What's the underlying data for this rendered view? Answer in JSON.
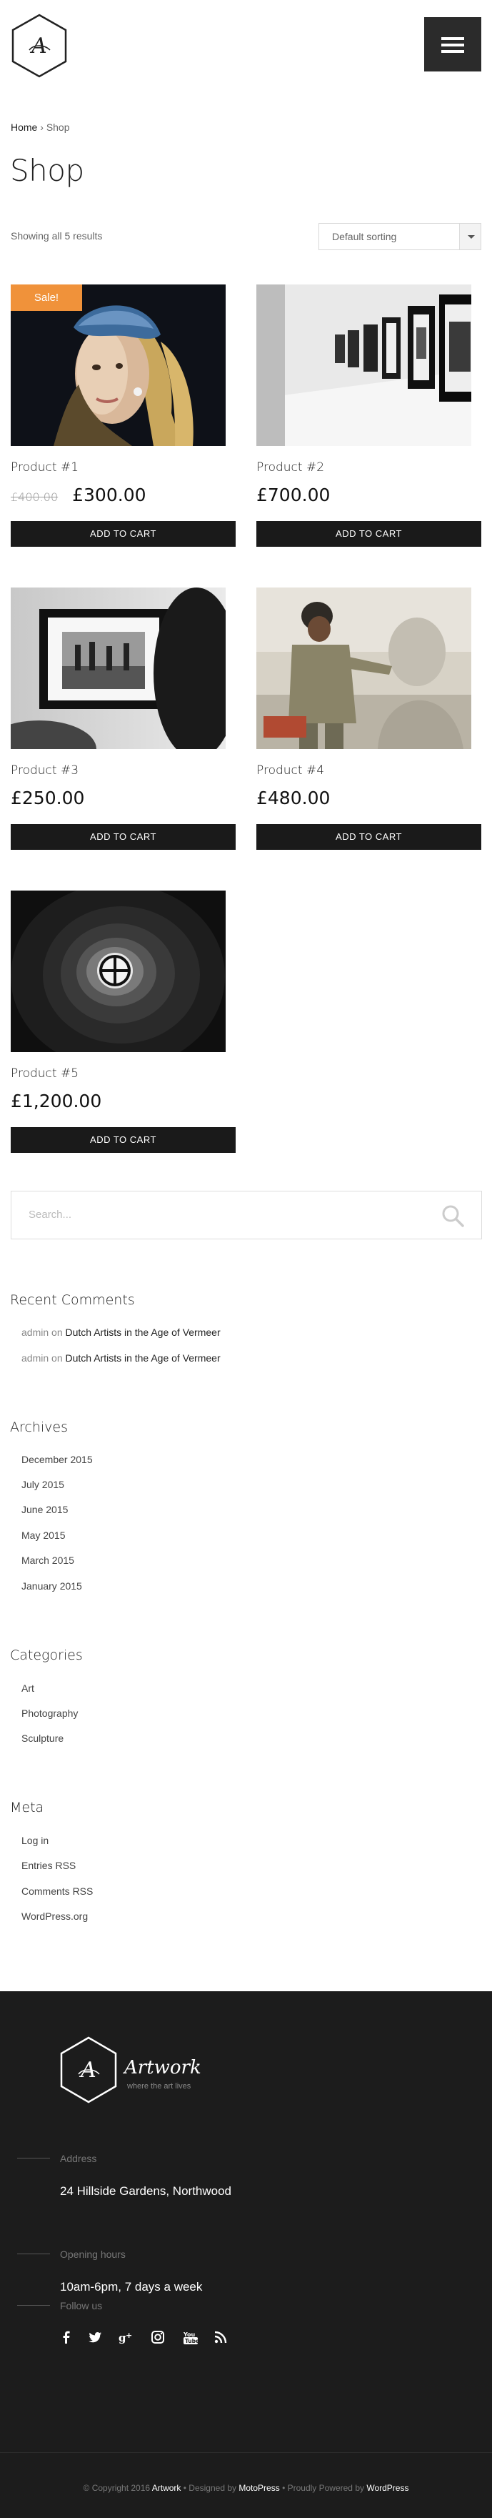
{
  "header": {
    "menu_icon": "hamburger-menu-icon",
    "logo_icon": "hexagon-monogram-logo-icon"
  },
  "breadcrumb": {
    "home": "Home",
    "separator": "›",
    "current": "Shop"
  },
  "page_title": "Shop",
  "toolbar": {
    "result_count": "Showing all 5 results",
    "sorting_value": "Default sorting"
  },
  "products": [
    {
      "name": "Product #1",
      "sale_badge": "Sale!",
      "old_price": "£400.00",
      "price": "£300.00",
      "button": "ADD TO CART"
    },
    {
      "name": "Product #2",
      "price": "£700.00",
      "button": "ADD TO CART"
    },
    {
      "name": "Product #3",
      "price": "£250.00",
      "button": "ADD TO CART"
    },
    {
      "name": "Product #4",
      "price": "£480.00",
      "button": "ADD TO CART"
    },
    {
      "name": "Product #5",
      "price": "£1,200.00",
      "button": "ADD TO CART"
    }
  ],
  "search": {
    "placeholder": "Search...",
    "icon": "search-icon"
  },
  "recent_comments": {
    "title": "Recent Comments",
    "items": [
      {
        "author": "admin",
        "on": "on",
        "post": "Dutch Artists in the Age of Vermeer"
      },
      {
        "author": "admin",
        "on": "on",
        "post": "Dutch Artists in the Age of Vermeer"
      }
    ]
  },
  "archives": {
    "title": "Archives",
    "items": [
      "December 2015",
      "July 2015",
      "June 2015",
      "May 2015",
      "March 2015",
      "January 2015"
    ]
  },
  "categories": {
    "title": "Categories",
    "items": [
      "Art",
      "Photography",
      "Sculpture"
    ]
  },
  "meta": {
    "title": "Meta",
    "items": [
      "Log in",
      "Entries RSS",
      "Comments RSS",
      "WordPress.org"
    ]
  },
  "footer": {
    "brand": "Artwork",
    "tagline": "where the art lives",
    "address_label": "Address",
    "address_value": "24 Hillside Gardens, Northwood",
    "hours_label": "Opening hours",
    "hours_value": "10am-6pm, 7 days a week",
    "follow_label": "Follow us",
    "social_icons": [
      "facebook-icon",
      "twitter-icon",
      "google-plus-icon",
      "instagram-icon",
      "youtube-icon",
      "rss-icon"
    ],
    "copyright_prefix": "© Copyright 2016",
    "copyright_brand": "Artwork",
    "copyright_mid": "• Designed by",
    "copyright_designer": "MotoPress",
    "copyright_powered": "• Proudly Powered by",
    "copyright_wp": "WordPress"
  }
}
